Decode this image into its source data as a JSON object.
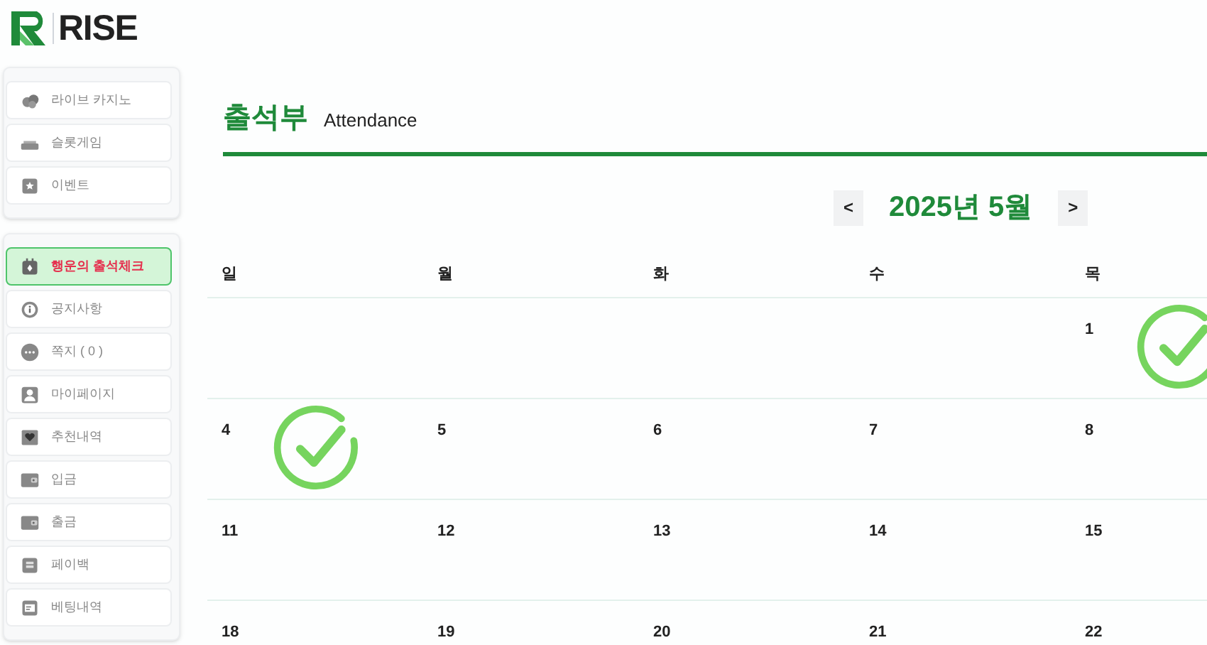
{
  "logo": {
    "text": "RISE"
  },
  "sidebar": {
    "groups": [
      {
        "items": [
          {
            "label": "라이브 카지노",
            "kind": "chips",
            "selected": false
          },
          {
            "label": "슬롯게임",
            "kind": "slot",
            "selected": false
          },
          {
            "label": "이벤트",
            "kind": "star",
            "selected": false
          }
        ]
      },
      {
        "items": [
          {
            "label": "행운의 출석체크",
            "kind": "calendar",
            "selected": true
          },
          {
            "label": "공지사항",
            "kind": "info",
            "selected": false
          },
          {
            "label": "쪽지 ( 0 )",
            "kind": "chat",
            "selected": false
          },
          {
            "label": "마이페이지",
            "kind": "user",
            "selected": false
          },
          {
            "label": "추천내역",
            "kind": "heart",
            "selected": false
          },
          {
            "label": "입금",
            "kind": "wallet",
            "selected": false
          },
          {
            "label": "출금",
            "kind": "wallet",
            "selected": false
          },
          {
            "label": "페이백",
            "kind": "coins",
            "selected": false
          },
          {
            "label": "베팅내역",
            "kind": "list",
            "selected": false
          }
        ]
      }
    ]
  },
  "page": {
    "title": "출석부",
    "subtitle": "Attendance"
  },
  "calendar": {
    "prev": "<",
    "month": "2025년 5월",
    "next": ">",
    "weekdays": [
      "일",
      "월",
      "화",
      "수",
      "목"
    ],
    "weeks": [
      [
        {
          "day": "1",
          "checked": true
        }
      ],
      [
        {
          "day": "4",
          "checked": true
        },
        {
          "day": "5"
        },
        {
          "day": "6"
        },
        {
          "day": "7"
        },
        {
          "day": "8"
        }
      ],
      [
        {
          "day": "11"
        },
        {
          "day": "12"
        },
        {
          "day": "13"
        },
        {
          "day": "14"
        },
        {
          "day": "15"
        }
      ],
      [
        {
          "day": "18"
        },
        {
          "day": "19"
        },
        {
          "day": "20"
        },
        {
          "day": "21"
        },
        {
          "day": "22"
        }
      ]
    ]
  }
}
